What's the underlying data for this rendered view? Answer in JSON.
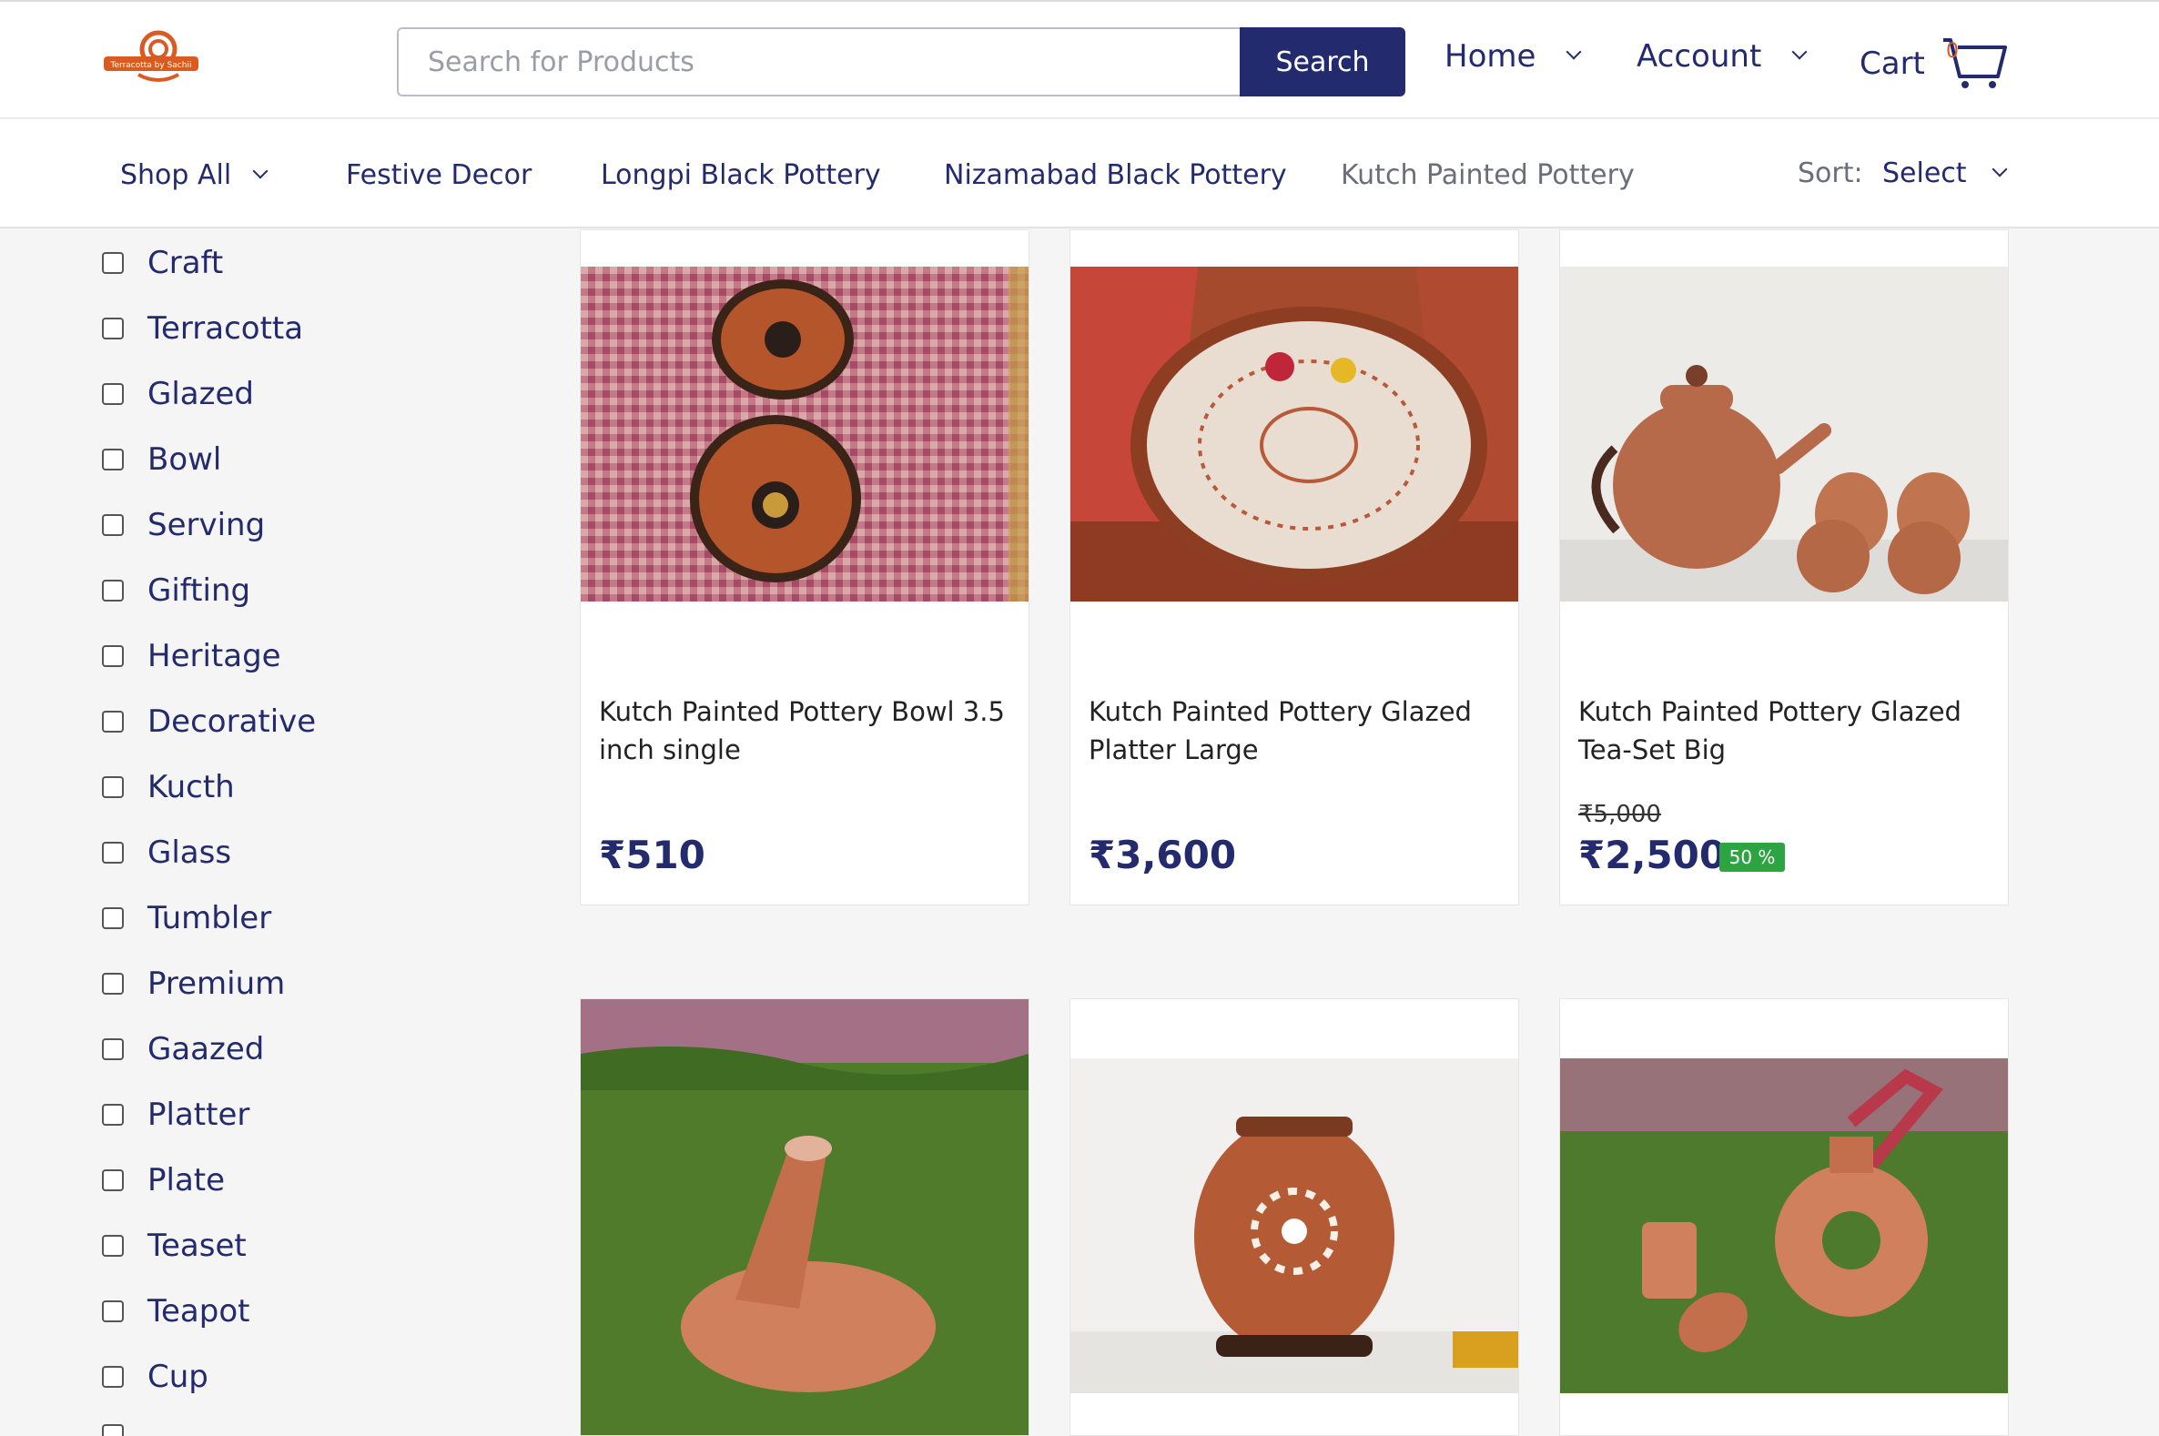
{
  "header": {
    "logo_text": "Terracotta by Sachii",
    "search_placeholder": "Search for Products",
    "search_button": "Search",
    "nav": [
      {
        "label": "Home"
      },
      {
        "label": "Account"
      },
      {
        "label": "Cart",
        "count": "0"
      }
    ]
  },
  "category_bar": {
    "items": [
      {
        "label": "Shop All"
      },
      {
        "label": "Festive Decor"
      },
      {
        "label": "Longpi Black Pottery"
      },
      {
        "label": "Nizamabad Black Pottery"
      },
      {
        "label": "Kutch Painted Pottery"
      }
    ],
    "sort_label": "Sort:",
    "sort_value": "Select"
  },
  "filters": [
    "Craft",
    "Terracotta",
    "Glazed",
    "Bowl",
    "Serving",
    "Gifting",
    "Heritage",
    "Decorative",
    "Kucth",
    "Glass",
    "Tumbler",
    "Premium",
    "Gaazed",
    "Platter",
    "Plate",
    "Teaset",
    "Teapot",
    "Cup"
  ],
  "products": [
    {
      "name": "Kutch Painted Pottery Bowl 3.5 inch single",
      "price": "₹510",
      "old_price": "",
      "discount": ""
    },
    {
      "name": "Kutch Painted Pottery Glazed Platter Large",
      "price": "₹3,600",
      "old_price": "",
      "discount": ""
    },
    {
      "name": "Kutch Painted Pottery Glazed Tea-Set Big",
      "price": "₹2,500",
      "old_price": "₹5,000",
      "discount": "50 %"
    },
    {
      "name": "",
      "price": "",
      "old_price": "",
      "discount": ""
    },
    {
      "name": "",
      "price": "",
      "old_price": "",
      "discount": ""
    },
    {
      "name": "",
      "price": "",
      "old_price": "",
      "discount": ""
    }
  ],
  "colors": {
    "brand": "#232a6e",
    "accent": "#d95b21",
    "discount": "#2da442"
  }
}
